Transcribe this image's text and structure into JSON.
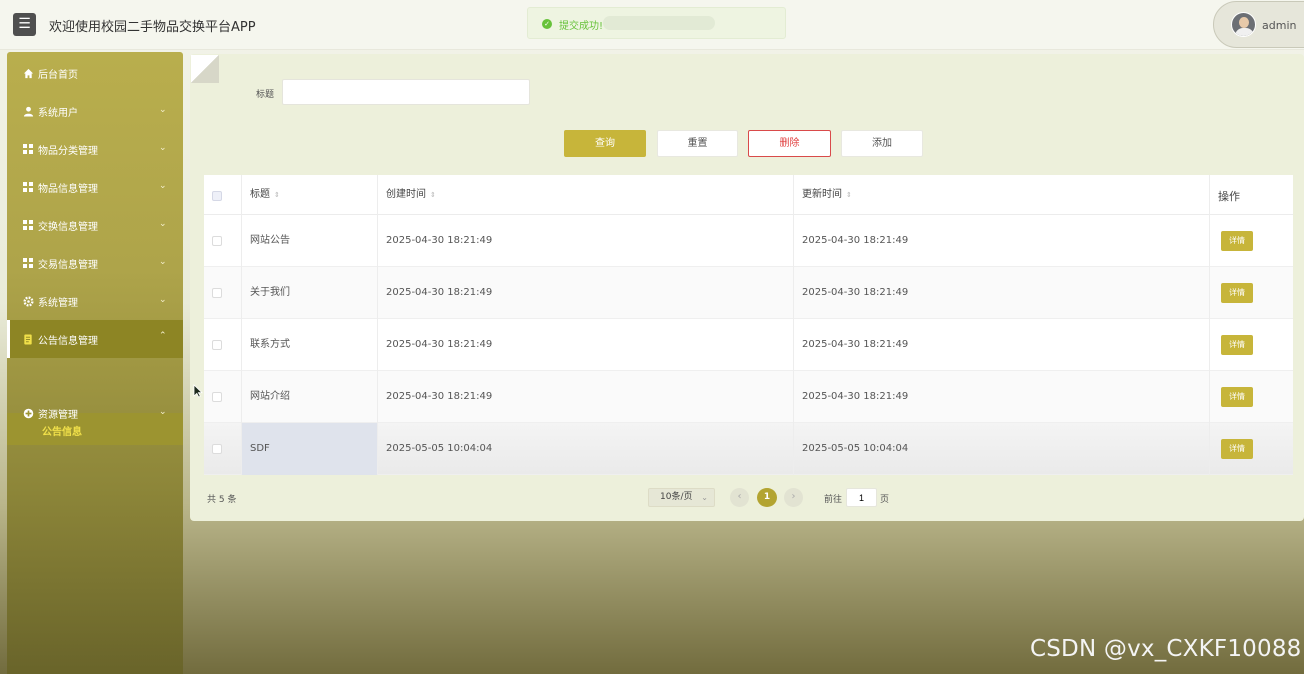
{
  "header": {
    "menu_icon": "hamburger-icon",
    "title": "欢迎使用校园二手物品交换平台APP",
    "user": {
      "name": "admin",
      "caret": "⌄"
    }
  },
  "toast": {
    "icon": "check-circle-icon",
    "message": "提交成功!"
  },
  "sidebar": {
    "items": [
      {
        "label": "后台首页",
        "icon": "home-icon",
        "has_caret": false
      },
      {
        "label": "系统用户",
        "icon": "user-icon",
        "has_caret": true
      },
      {
        "label": "物品分类管理",
        "icon": "grid-icon",
        "has_caret": true
      },
      {
        "label": "物品信息管理",
        "icon": "grid-icon",
        "has_caret": true
      },
      {
        "label": "交换信息管理",
        "icon": "grid-icon",
        "has_caret": true
      },
      {
        "label": "交易信息管理",
        "icon": "grid-icon",
        "has_caret": true
      },
      {
        "label": "系统管理",
        "icon": "gear-icon",
        "has_caret": true
      },
      {
        "label": "公告信息管理",
        "icon": "document-icon",
        "has_caret": true,
        "active": true
      },
      {
        "label": "资源管理",
        "icon": "plus-circle-icon",
        "has_caret": true
      }
    ],
    "sub_item": {
      "label": "公告信息"
    }
  },
  "search": {
    "label": "标题",
    "value": "",
    "placeholder": ""
  },
  "buttons": {
    "query": "查询",
    "reset": "重置",
    "delete": "删除",
    "add": "添加"
  },
  "table": {
    "headers": {
      "title": "标题",
      "created": "创建时间",
      "updated": "更新时间",
      "actions": "操作"
    },
    "sort_glyph": "⇕",
    "detail_label": "详情",
    "rows": [
      {
        "title": "网站公告",
        "created": "2025-04-30 18:21:49",
        "updated": "2025-04-30 18:21:49"
      },
      {
        "title": "关于我们",
        "created": "2025-04-30 18:21:49",
        "updated": "2025-04-30 18:21:49"
      },
      {
        "title": "联系方式",
        "created": "2025-04-30 18:21:49",
        "updated": "2025-04-30 18:21:49"
      },
      {
        "title": "网站介绍",
        "created": "2025-04-30 18:21:49",
        "updated": "2025-04-30 18:21:49"
      },
      {
        "title": "SDF",
        "created": "2025-05-05 10:04:04",
        "updated": "2025-05-05 10:04:04"
      }
    ]
  },
  "pagination": {
    "total": "共 5 条",
    "page_size": "10条/页",
    "prev": "‹",
    "next": "›",
    "current_page": "1",
    "goto_prefix": "前往",
    "goto_value": "1",
    "goto_suffix": "页"
  },
  "watermark": "CSDN @vx_CXKF10088",
  "colors": {
    "accent": "#c7b53a",
    "sidebar": "#aea44a",
    "danger": "#e03e3e",
    "success": "#67c23a"
  }
}
